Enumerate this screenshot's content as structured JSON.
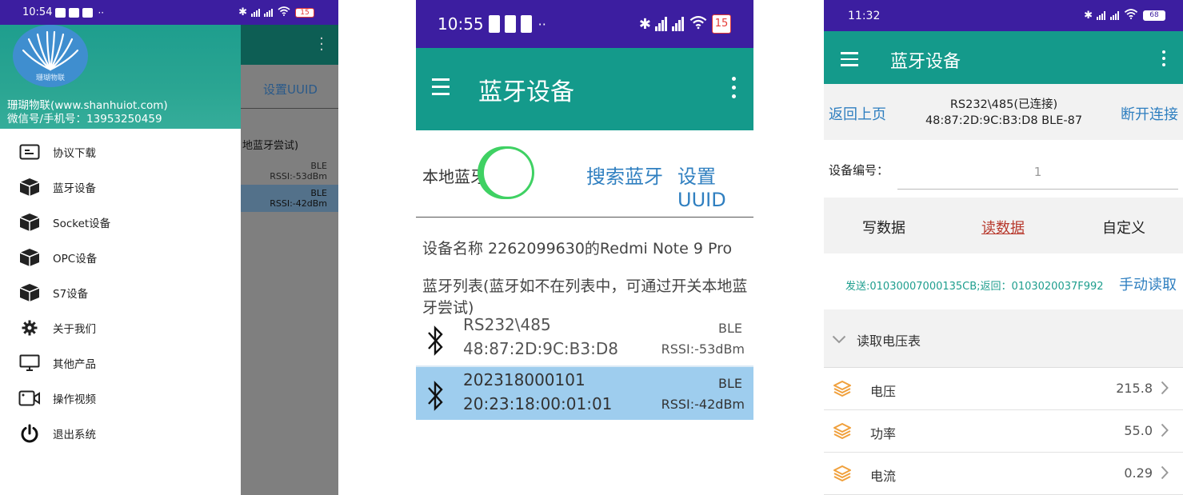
{
  "phone1": {
    "status": {
      "time": "10:54",
      "battery": "15"
    },
    "drawer": {
      "logo_text": "珊瑚物联",
      "company": "珊瑚物联(www.shanhuiot.com)",
      "contact": "微信号/手机号：13953250459",
      "items": [
        {
          "label": "协议下载",
          "icon": "download-icon"
        },
        {
          "label": "蓝牙设备",
          "icon": "cube-icon"
        },
        {
          "label": "Socket设备",
          "icon": "cube-icon"
        },
        {
          "label": "OPC设备",
          "icon": "cube-icon"
        },
        {
          "label": "S7设备",
          "icon": "cube-icon"
        },
        {
          "label": "关于我们",
          "icon": "gear-icon"
        },
        {
          "label": "其他产品",
          "icon": "monitor-icon"
        },
        {
          "label": "操作视频",
          "icon": "video-icon"
        },
        {
          "label": "退出系统",
          "icon": "power-icon"
        }
      ]
    },
    "behind": {
      "uuid_label": "设置UUID",
      "hint": "地蓝牙尝试)",
      "rows": [
        {
          "type": "BLE",
          "rssi": "RSSI:-53dBm"
        },
        {
          "type": "BLE",
          "rssi": "RSSI:-42dBm"
        }
      ]
    }
  },
  "phone2": {
    "status": {
      "time": "10:55",
      "battery": "15"
    },
    "title": "蓝牙设备",
    "local_bt_label": "本地蓝牙",
    "local_bt_on": true,
    "search_label": "搜索蓝牙",
    "uuid_label": "设置UUID",
    "device_name": "设备名称  2262099630的Redmi Note 9 Pro",
    "list_hint": "蓝牙列表(蓝牙如不在列表中，可通过开关本地蓝牙尝试)",
    "devices": [
      {
        "name": "RS232\\485",
        "mac": "48:87:2D:9C:B3:D8",
        "type": "BLE",
        "rssi": "RSSI:-53dBm",
        "selected": false
      },
      {
        "name": "202318000101",
        "mac": "20:23:18:00:01:01",
        "type": "BLE",
        "rssi": "RSSI:-42dBm",
        "selected": true
      }
    ]
  },
  "phone3": {
    "status": {
      "time": "11:32",
      "battery": "68"
    },
    "title": "蓝牙设备",
    "back_label": "返回上页",
    "device_line1": "RS232\\485(已连接)",
    "device_line2": "48:87:2D:9C:B3:D8  BLE-87",
    "disconnect_label": "断开连接",
    "device_no_label": "设备编号：",
    "device_no_value": "1",
    "tabs": [
      "写数据",
      "读数据",
      "自定义"
    ],
    "active_tab": "读数据",
    "send_text": "发送:01030007000135CB;返回：0103020037F992",
    "manual_read_label": "手动读取",
    "section_title": "读取电压表",
    "items": [
      {
        "label": "电压",
        "value": "215.8"
      },
      {
        "label": "功率",
        "value": "55.0"
      },
      {
        "label": "电流",
        "value": "0.29"
      }
    ],
    "accent_color": "#149a8b",
    "link_color": "#2f7fc0",
    "active_tab_color": "#b83a2e"
  }
}
